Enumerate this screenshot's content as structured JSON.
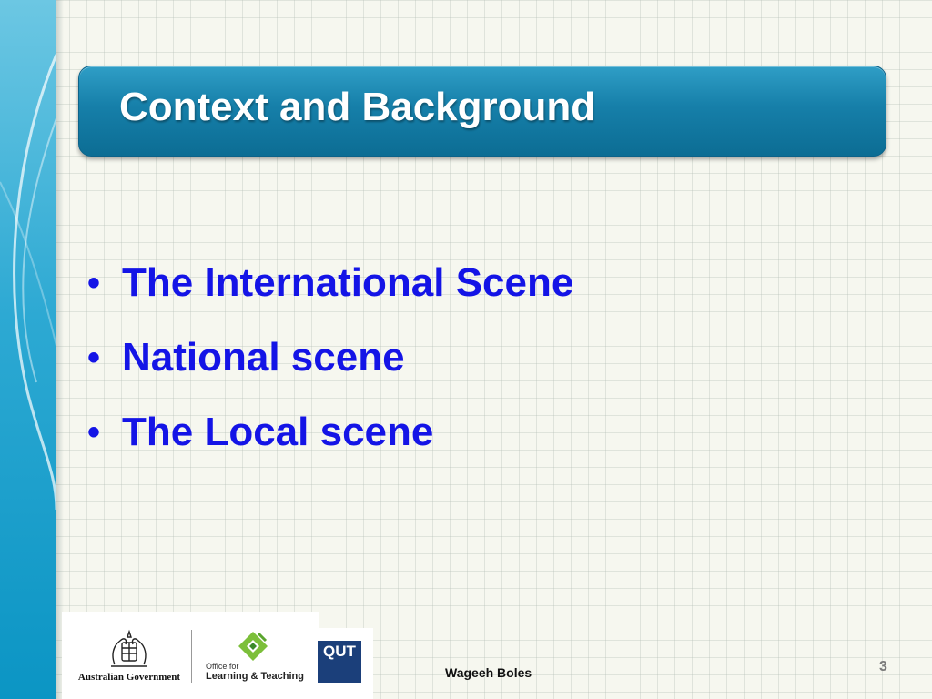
{
  "slide": {
    "title": "Context and Background",
    "bullets": [
      "The International Scene",
      "National scene",
      "The Local scene"
    ],
    "footer": {
      "author": "Wageeh Boles",
      "page_number": "3",
      "logos": {
        "australian_government": "Australian Government",
        "olt_office_for": "Office for",
        "olt_name": "Learning & Teaching",
        "qut": "QUT"
      }
    }
  },
  "colors": {
    "title_bar": "#167fa9",
    "bullet_text": "#1414e6",
    "left_band": "#2da9d3"
  }
}
